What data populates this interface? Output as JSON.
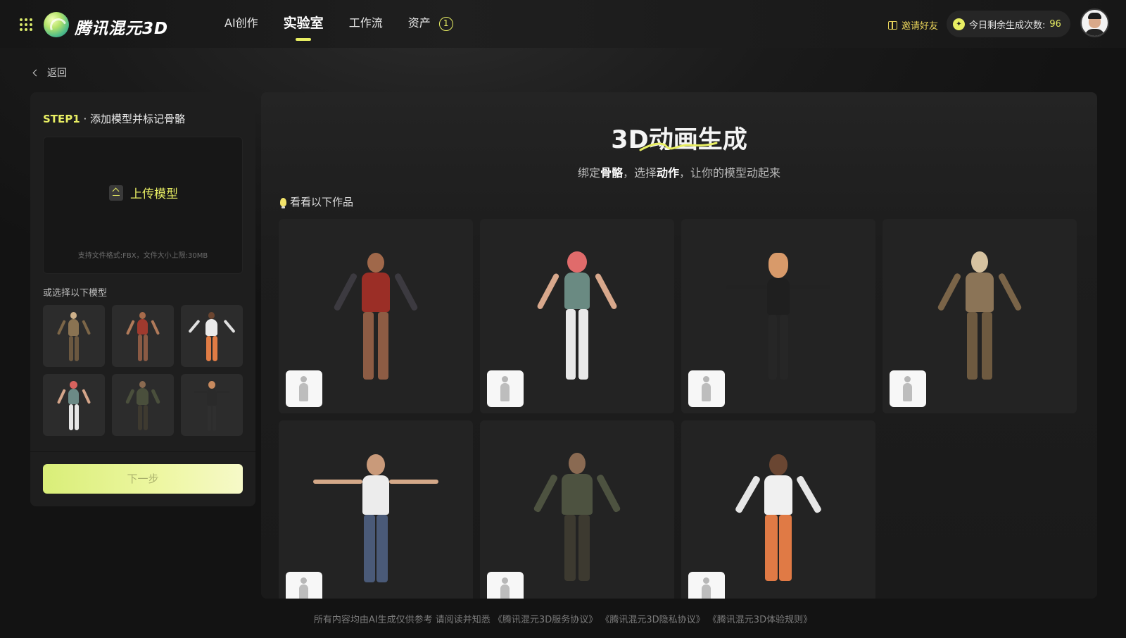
{
  "header": {
    "logo_text": "腾讯混元3D",
    "nav": [
      {
        "label": "AI创作"
      },
      {
        "label": "实验室",
        "active": true
      },
      {
        "label": "工作流"
      },
      {
        "label": "资产",
        "badge": "1"
      }
    ],
    "invite_label": "邀请好友",
    "quota_label": "今日剩余生成次数:",
    "quota_value": "96",
    "accent_color": "#e8ee63"
  },
  "back_label": "返回",
  "left_panel": {
    "step_label": "STEP1",
    "step_text": "· 添加模型并标记骨骼",
    "upload_label": "上传模型",
    "upload_hint": "支持文件格式:FBX，文件大小上限:30MB",
    "choose_label": "或选择以下模型",
    "next_button": "下一步"
  },
  "main": {
    "title": "3D动画生成",
    "subtitle_parts": [
      "绑定",
      "骨骼",
      "，选择",
      "动作",
      "，让你的模型动起来"
    ],
    "gallery_label": "看看以下作品"
  },
  "footer": {
    "notice": "所有内容均由AI生成仅供参考 请阅读并知悉",
    "links": [
      "《腾讯混元3D服务协议》",
      "《腾讯混元3D隐私协议》",
      "《腾讯混元3D体验规则》"
    ]
  }
}
